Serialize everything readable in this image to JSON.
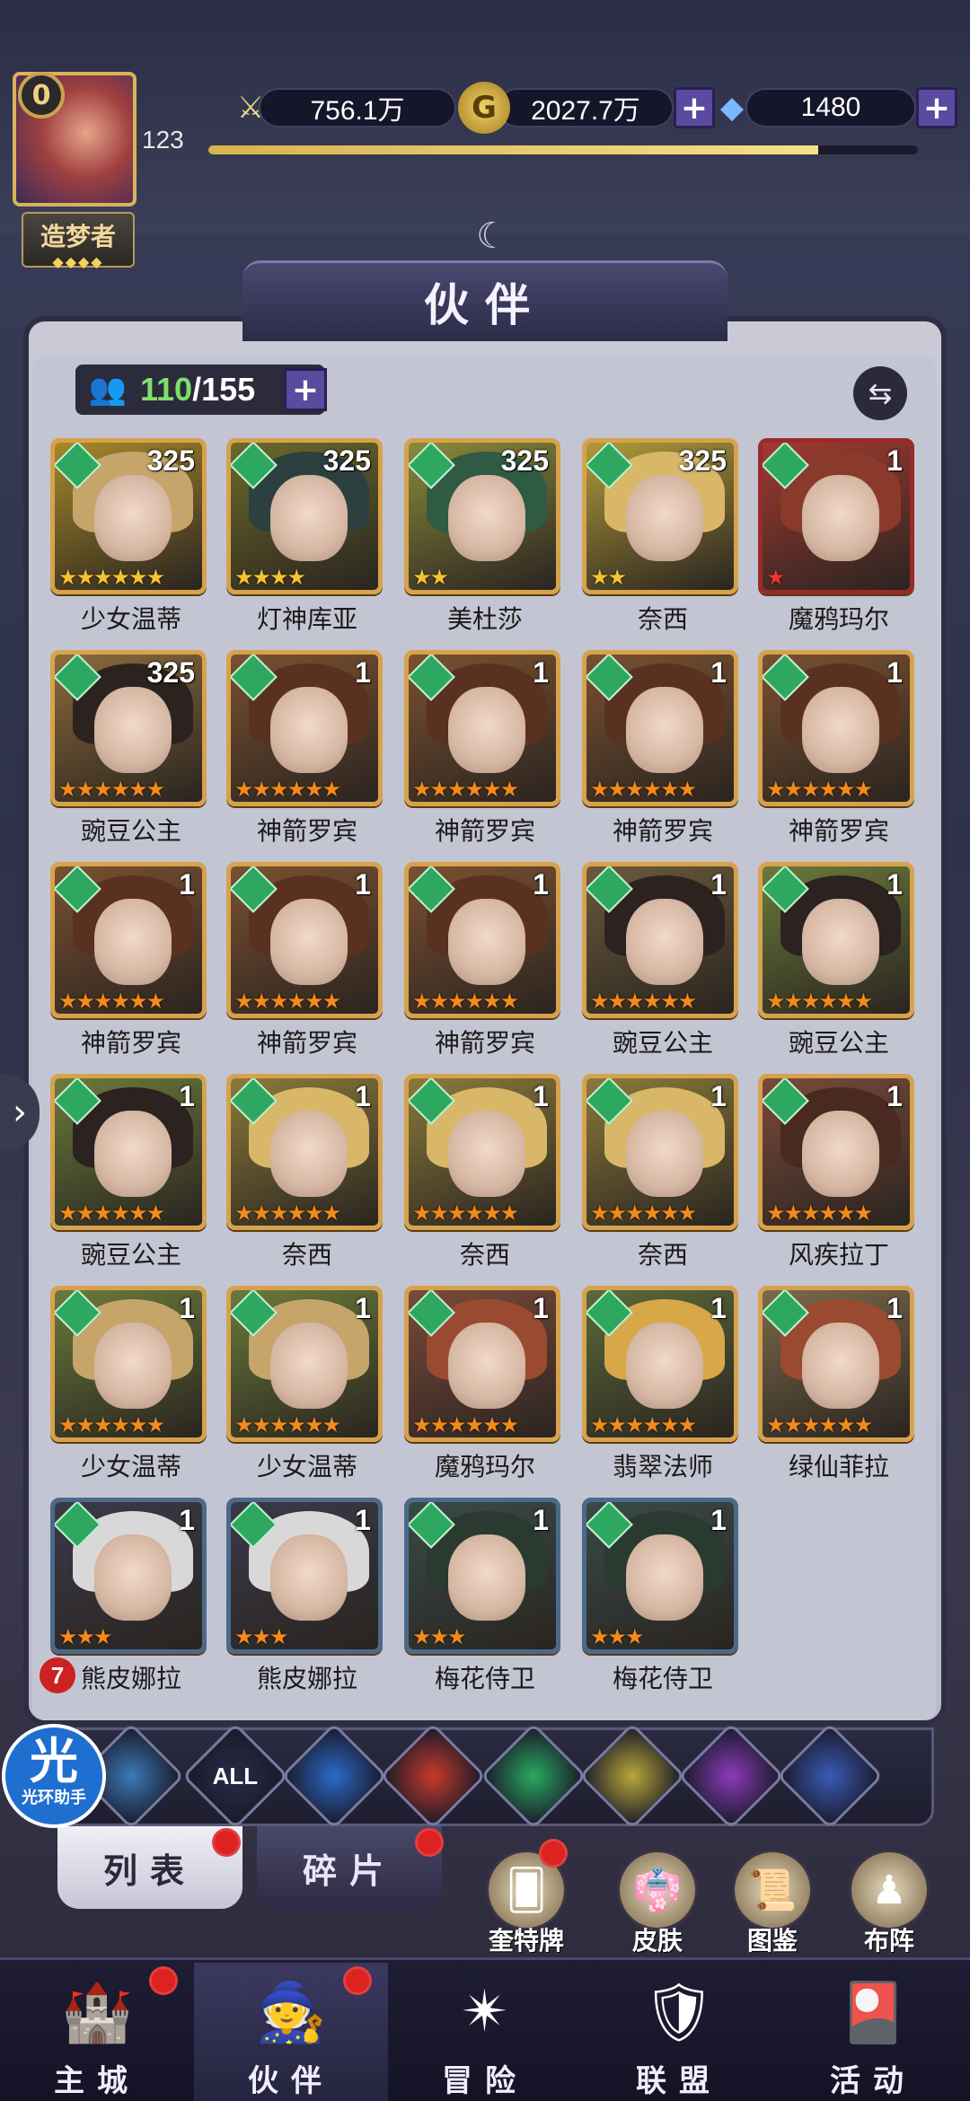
{
  "header": {
    "vip_level": "0",
    "player_level": "123",
    "player_title": "造梦者",
    "power": "756.1万",
    "gold": "2027.7万",
    "diamonds": "1480",
    "xp_fraction": 0.86,
    "plus": "+"
  },
  "panel": {
    "title": "伙伴",
    "count_current": "110",
    "count_max": "/155"
  },
  "partners": [
    {
      "name": "少女温蒂",
      "level": "325",
      "stars": 6,
      "star_color": "#f4c331",
      "frame": "#d7a24c",
      "bg": "#a6882a",
      "hair": "#c6a56a"
    },
    {
      "name": "灯神库亚",
      "level": "325",
      "stars": 4,
      "star_color": "#f4c331",
      "frame": "#d7a24c",
      "bg": "#6b6a2a",
      "hair": "#2c4040"
    },
    {
      "name": "美杜莎",
      "level": "325",
      "stars": 2,
      "star_color": "#f4c331",
      "frame": "#d7a24c",
      "bg": "#8a8a3a",
      "hair": "#2f5a44"
    },
    {
      "name": "奈西",
      "level": "325",
      "stars": 2,
      "star_color": "#f4c331",
      "frame": "#d7a24c",
      "bg": "#b09a3a",
      "hair": "#d8b868"
    },
    {
      "name": "魔鸦玛尔",
      "level": "1",
      "stars": 1,
      "star_color": "#e33",
      "frame": "#9a2a2a",
      "bg": "#a03a30",
      "hair": "#8a3a2a"
    },
    {
      "name": "豌豆公主",
      "level": "325",
      "stars": 6,
      "star_color": "#f28a1c",
      "frame": "#d7a24c",
      "bg": "#8a6a3a",
      "hair": "#2c2220"
    },
    {
      "name": "神箭罗宾",
      "level": "1",
      "stars": 6,
      "star_color": "#f28a1c",
      "frame": "#d7a24c",
      "bg": "#7a5030",
      "hair": "#5a3020"
    },
    {
      "name": "神箭罗宾",
      "level": "1",
      "stars": 6,
      "star_color": "#f28a1c",
      "frame": "#d7a24c",
      "bg": "#7a5030",
      "hair": "#5a3020"
    },
    {
      "name": "神箭罗宾",
      "level": "1",
      "stars": 6,
      "star_color": "#f28a1c",
      "frame": "#d7a24c",
      "bg": "#7a5030",
      "hair": "#5a3020"
    },
    {
      "name": "神箭罗宾",
      "level": "1",
      "stars": 6,
      "star_color": "#f28a1c",
      "frame": "#d7a24c",
      "bg": "#7a5030",
      "hair": "#5a3020"
    },
    {
      "name": "神箭罗宾",
      "level": "1",
      "stars": 6,
      "star_color": "#f28a1c",
      "frame": "#d7a24c",
      "bg": "#7a5030",
      "hair": "#5a3020"
    },
    {
      "name": "神箭罗宾",
      "level": "1",
      "stars": 6,
      "star_color": "#f28a1c",
      "frame": "#d7a24c",
      "bg": "#7a5030",
      "hair": "#5a3020"
    },
    {
      "name": "神箭罗宾",
      "level": "1",
      "stars": 6,
      "star_color": "#f28a1c",
      "frame": "#d7a24c",
      "bg": "#7a5030",
      "hair": "#5a3020"
    },
    {
      "name": "豌豆公主",
      "level": "1",
      "stars": 6,
      "star_color": "#f28a1c",
      "frame": "#d7a24c",
      "bg": "#6a5a3a",
      "hair": "#2c2220"
    },
    {
      "name": "豌豆公主",
      "level": "1",
      "stars": 6,
      "star_color": "#f28a1c",
      "frame": "#d7a24c",
      "bg": "#6a7a3a",
      "hair": "#2c2220"
    },
    {
      "name": "豌豆公主",
      "level": "1",
      "stars": 6,
      "star_color": "#f28a1c",
      "frame": "#d7a24c",
      "bg": "#6a7a3a",
      "hair": "#2c2220"
    },
    {
      "name": "奈西",
      "level": "1",
      "stars": 6,
      "star_color": "#f28a1c",
      "frame": "#d7a24c",
      "bg": "#8a7a3a",
      "hair": "#d8b868"
    },
    {
      "name": "奈西",
      "level": "1",
      "stars": 6,
      "star_color": "#f28a1c",
      "frame": "#d7a24c",
      "bg": "#8a7a3a",
      "hair": "#d8b868"
    },
    {
      "name": "奈西",
      "level": "1",
      "stars": 6,
      "star_color": "#f28a1c",
      "frame": "#d7a24c",
      "bg": "#8a7a3a",
      "hair": "#d8b868"
    },
    {
      "name": "风疾拉丁",
      "level": "1",
      "stars": 6,
      "star_color": "#f28a1c",
      "frame": "#d7a24c",
      "bg": "#7a4a3a",
      "hair": "#4a2a20"
    },
    {
      "name": "少女温蒂",
      "level": "1",
      "stars": 6,
      "star_color": "#f28a1c",
      "frame": "#d7a24c",
      "bg": "#6a7a3a",
      "hair": "#c6a56a"
    },
    {
      "name": "少女温蒂",
      "level": "1",
      "stars": 6,
      "star_color": "#f28a1c",
      "frame": "#d7a24c",
      "bg": "#6a7a3a",
      "hair": "#c6a56a"
    },
    {
      "name": "魔鸦玛尔",
      "level": "1",
      "stars": 6,
      "star_color": "#f28a1c",
      "frame": "#d7a24c",
      "bg": "#7a4a3a",
      "hair": "#9a4a30"
    },
    {
      "name": "翡翠法师",
      "level": "1",
      "stars": 6,
      "star_color": "#f28a1c",
      "frame": "#d7a24c",
      "bg": "#5a6a3a",
      "hair": "#d8a848"
    },
    {
      "name": "绿仙菲拉",
      "level": "1",
      "stars": 6,
      "star_color": "#f28a1c",
      "frame": "#d7a24c",
      "bg": "#7a6a4a",
      "hair": "#9a4a30"
    },
    {
      "name": "熊皮娜拉",
      "level": "1",
      "stars": 3,
      "star_color": "#f28a1c",
      "frame": "#4a6a8a",
      "bg": "#3a3a48",
      "hair": "#d8d8d8"
    },
    {
      "name": "熊皮娜拉",
      "level": "1",
      "stars": 3,
      "star_color": "#f28a1c",
      "frame": "#4a6a8a",
      "bg": "#3a3a48",
      "hair": "#d8d8d8"
    },
    {
      "name": "梅花侍卫",
      "level": "1",
      "stars": 3,
      "star_color": "#f28a1c",
      "frame": "#4a6a8a",
      "bg": "#3a4a48",
      "hair": "#2a3a30"
    },
    {
      "name": "梅花侍卫",
      "level": "1",
      "stars": 3,
      "star_color": "#f28a1c",
      "frame": "#4a6a8a",
      "bg": "#3a4a48",
      "hair": "#2a3a30"
    }
  ],
  "filters": [
    {
      "name": "filter-light-icon",
      "label": "",
      "color": "#3a7ab8"
    },
    {
      "name": "filter-all-button",
      "label": "ALL",
      "color": "#2a2a48"
    },
    {
      "name": "filter-water-icon",
      "label": "",
      "color": "#2a6ac8"
    },
    {
      "name": "filter-fire-icon",
      "label": "",
      "color": "#c83a2a"
    },
    {
      "name": "filter-wind-icon",
      "label": "",
      "color": "#2aa860"
    },
    {
      "name": "filter-earth-icon",
      "label": "",
      "color": "#b8a83a"
    },
    {
      "name": "filter-moon-icon",
      "label": "",
      "color": "#8a3ab8"
    },
    {
      "name": "filter-planet-icon",
      "label": "",
      "color": "#3a5ab8"
    }
  ],
  "tabs": {
    "list": "列表",
    "fragments": "碎片"
  },
  "tools": [
    {
      "name": "tool-cards",
      "label": "奎特牌",
      "icon": "🂠"
    },
    {
      "name": "tool-skins",
      "label": "皮肤",
      "icon": "👘"
    },
    {
      "name": "tool-codex",
      "label": "图鉴",
      "icon": "📜"
    },
    {
      "name": "tool-formation",
      "label": "布阵",
      "icon": "♟"
    }
  ],
  "nav": [
    {
      "name": "nav-main-city",
      "label": "主城",
      "icon": "🏰"
    },
    {
      "name": "nav-partners",
      "label": "伙伴",
      "icon": "🧙"
    },
    {
      "name": "nav-adventure",
      "label": "冒险",
      "icon": "✴"
    },
    {
      "name": "nav-alliance",
      "label": "联盟",
      "icon": "🛡"
    },
    {
      "name": "nav-events",
      "label": "活动",
      "icon": "🎴"
    }
  ],
  "chat": {
    "badge": "7"
  },
  "helper": {
    "big": "光",
    "small": "光环助手"
  }
}
